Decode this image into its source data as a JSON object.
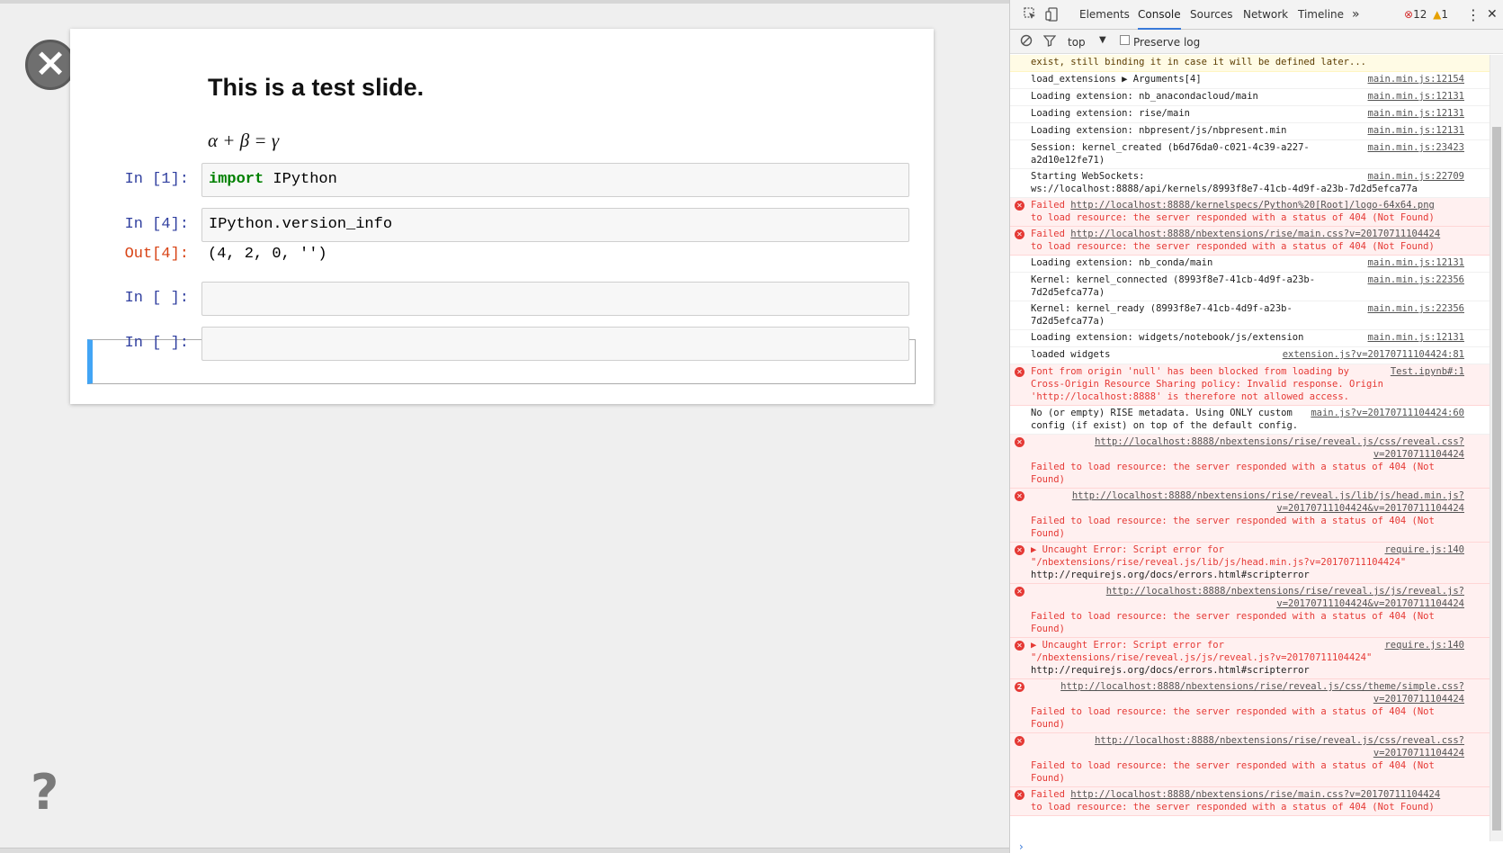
{
  "slide": {
    "close_icon": "×",
    "help_icon": "?",
    "title": "This is a test slide.",
    "math": "α + β = γ",
    "cells": [
      {
        "prompt": "In [1]:",
        "keyword": "import",
        "code": " IPython"
      },
      {
        "prompt": "In [4]:",
        "code": "IPython.version_info",
        "out_prompt": "Out[4]:",
        "output": "(4, 2, 0, '')"
      },
      {
        "prompt": "In [ ]:",
        "code": ""
      },
      {
        "prompt": "In [ ]:",
        "code": ""
      }
    ]
  },
  "devtools": {
    "tabs": [
      "Elements",
      "Console",
      "Sources",
      "Network",
      "Timeline"
    ],
    "more": "»",
    "error_count": "12",
    "warning_count": "1",
    "menu_icon": "⋮",
    "close": "✕",
    "context": "top",
    "preserve_log": "Preserve log",
    "messages": [
      {
        "type": "warn",
        "text": "exist, still binding it in case it will be defined later..."
      },
      {
        "type": "log",
        "text": "load_extensions  ▶ Arguments[4]",
        "src": "main.min.js:12154"
      },
      {
        "type": "log",
        "text": "Loading extension: nb_anacondacloud/main",
        "src": "main.min.js:12131"
      },
      {
        "type": "log",
        "text": "Loading extension: rise/main",
        "src": "main.min.js:12131"
      },
      {
        "type": "log",
        "text": "Loading extension: nbpresent/js/nbpresent.min",
        "src": "main.min.js:12131"
      },
      {
        "type": "log",
        "text": "Session: kernel_created (b6d76da0-c021-4c39-a227-a2d10e12fe71)",
        "src": "main.min.js:23423"
      },
      {
        "type": "log",
        "text": "Starting WebSockets: ws://localhost:8888/api/kernels/8993f8e7-41cb-4d9f-a23b-7d2d5efca77a",
        "src": "main.min.js:22709"
      },
      {
        "type": "error",
        "text": "Failed ",
        "url": "http://localhost:8888/kernelspecs/Python%20[Root]/logo-64x64.png",
        "text2": "to load resource: the server responded with a status of 404 (Not Found)"
      },
      {
        "type": "error",
        "text": "Failed ",
        "url": "http://localhost:8888/nbextensions/rise/main.css?v=20170711104424",
        "text2": "to load resource: the server responded with a status of 404 (Not Found)"
      },
      {
        "type": "log",
        "text": "Loading extension: nb_conda/main",
        "src": "main.min.js:12131"
      },
      {
        "type": "log",
        "text": "Kernel: kernel_connected (8993f8e7-41cb-4d9f-a23b-7d2d5efca77a)",
        "src": "main.min.js:22356"
      },
      {
        "type": "log",
        "text": "Kernel: kernel_ready (8993f8e7-41cb-4d9f-a23b-7d2d5efca77a)",
        "src": "main.min.js:22356"
      },
      {
        "type": "log",
        "text": "Loading extension: widgets/notebook/js/extension",
        "src": "main.min.js:12131"
      },
      {
        "type": "log",
        "text": "loaded widgets",
        "src": "extension.js?v=20170711104424:81"
      },
      {
        "type": "error",
        "text": "Font from origin 'null' has been blocked from loading by Cross-Origin Resource Sharing policy: Invalid response. Origin 'http://localhost:8888' is therefore not allowed access.",
        "src": "Test.ipynb#:1"
      },
      {
        "type": "log",
        "text": "No (or empty) RISE metadata. Using ONLY custom config (if exist) on top of the default config.",
        "src": "main.js?v=20170711104424:60"
      },
      {
        "type": "error",
        "url": "http://localhost:8888/nbextensions/rise/reveal.js/css/reveal.css?v=20170711104424",
        "text2": "Failed to load resource: the server responded with a status of 404 (Not Found)"
      },
      {
        "type": "error",
        "url": "http://localhost:8888/nbextensions/rise/reveal.js/lib/js/head.min.js?v=20170711104424&v=20170711104424",
        "text2": "Failed to load resource: the server responded with a status of 404 (Not Found)"
      },
      {
        "type": "error",
        "text": "▶ Uncaught Error: Script error for \"/nbextensions/rise/reveal.js/lib/js/head.min.js?v=20170711104424\"",
        "text3": "http://requirejs.org/docs/errors.html#scripterror",
        "src": "require.js:140"
      },
      {
        "type": "error",
        "url": "http://localhost:8888/nbextensions/rise/reveal.js/js/reveal.js?v=20170711104424&v=20170711104424",
        "text2": "Failed to load resource: the server responded with a status of 404 (Not Found)"
      },
      {
        "type": "error",
        "text": "▶ Uncaught Error: Script error for \"/nbextensions/rise/reveal.js/js/reveal.js?v=20170711104424\"",
        "text3": "http://requirejs.org/docs/errors.html#scripterror",
        "src": "require.js:140"
      },
      {
        "type": "error",
        "badge": "2",
        "url": "http://localhost:8888/nbextensions/rise/reveal.js/css/theme/simple.css?v=20170711104424",
        "text2": "Failed to load resource: the server responded with a status of 404 (Not Found)"
      },
      {
        "type": "error",
        "url": "http://localhost:8888/nbextensions/rise/reveal.js/css/reveal.css?v=20170711104424",
        "text2": "Failed to load resource: the server responded with a status of 404 (Not Found)"
      },
      {
        "type": "error",
        "text": "Failed ",
        "url": "http://localhost:8888/nbextensions/rise/main.css?v=20170711104424",
        "text2": "to load resource: the server responded with a status of 404 (Not Found)"
      }
    ],
    "prompt": "›"
  }
}
